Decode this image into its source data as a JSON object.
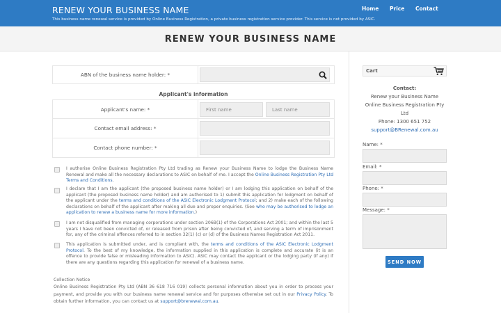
{
  "header": {
    "brand": "RENEW YOUR BUSINESS NAME",
    "tagline": "This business name renewal service is provided by Online Business Registration, a private business registration service provider. This service is not provided by ASIC.",
    "nav": [
      "Home",
      "Price",
      "Contact"
    ]
  },
  "page": {
    "title": "RENEW YOUR BUSINESS NAME"
  },
  "form": {
    "abn_label": "ABN of the business name holder: *",
    "abn_value": "",
    "applicant_heading": "Applicant's information",
    "name_label": "Applicant's name: *",
    "first_placeholder": "First name",
    "last_placeholder": "Last name",
    "email_label": "Contact email address: *",
    "phone_label": "Contact phone number: *"
  },
  "declarations": [
    {
      "pre": "I authorise Online Business Registration Pty Ltd trading as Renew your Business Name to lodge the Business Name Renewal and make all the necessary declarations to ASIC on behalf of me. I accept the ",
      "link": "Online Business Registration Pty Ltd Terms and Conditions",
      "post": "."
    },
    {
      "pre": "I declare that I am the applicant (the proposed business name holder) or I am lodging this application on behalf of the applicant (the proposed business name holder) and am authorised to 1) submit this application for lodgment on behalf of the applicant under the ",
      "link": "terms and conditions of the ASIC Electronic Lodgment Protocol",
      "mid": "; and 2) make each of the following declarations on behalf of the applicant after making all due and proper enquiries. (See ",
      "link2": "who may be authorised to lodge an application to renew a business name for more information.",
      "post": ")"
    },
    {
      "text": "I am not disqualified from managing corporations under section 206B(1) of the Corporations Act 2001; and within the last 5 years I have not been convicted of, or released from prison after being convicted of, and serving a term of imprisonment for, any of the criminal offences referred to in section 32(1) (c) or (d) of the Business Names Registration Act 2011."
    },
    {
      "pre": "This application is submitted under, and is compliant with, the ",
      "link": "terms and conditions of the ASIC Electronic Lodgment Protocol",
      "post": ". To the best of my knowledge, the information supplied in this application is complete and accurate (it is an offence to provide false or misleading information to ASIC). ASIC may contact the applicant or the lodging party (if any) if there are any questions regarding this application for renewal of a business name."
    }
  ],
  "collection": {
    "title": "Collection Notice",
    "pre": "Online Business Registration Pty Ltd (ABN 36 618 716 019) collects personal information about you in order to process your payment, and provide you with our business name renewal service and for purposes otherwise set out in our ",
    "link": "Privacy Policy",
    "mid": ". To obtain further information, you can contact us at ",
    "email": "support@brenewal.com.au",
    "post": "."
  },
  "sidebar": {
    "cart_label": "Cart",
    "contact_heading": "Contact:",
    "contact_line1": "Renew your Business Name",
    "contact_line2": "Online Business Registration Pty Ltd",
    "phone": "Phone: 1300 651 752",
    "email": "support@BRenewal.com.au",
    "name_label": "Name: *",
    "email_label": "Email: *",
    "phone_label": "Phone: *",
    "message_label": "Message: *",
    "send_label": "SEND NOW"
  },
  "colors": {
    "brand_blue": "#2e7bc4",
    "link_blue": "#2e6db4"
  }
}
